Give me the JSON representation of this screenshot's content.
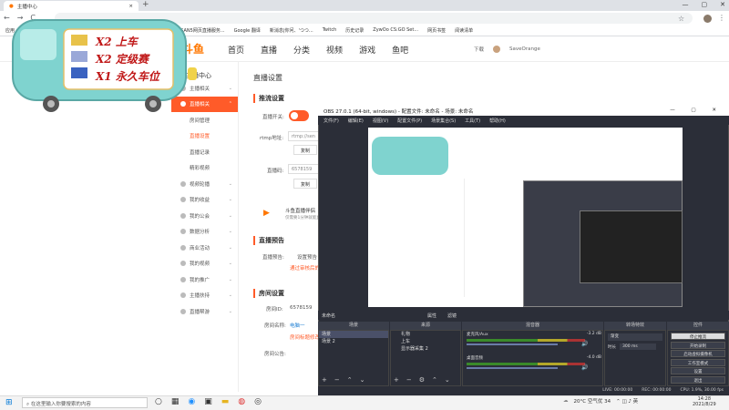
{
  "browser": {
    "tab_title": "主播中心",
    "tab_close": "×",
    "new_tab": "+",
    "win_min": "—",
    "win_max": "▢",
    "win_close": "✕",
    "back": "←",
    "forward": "→",
    "reload": "C",
    "bookmarks": [
      "应用",
      "...",
      "Debian",
      "reddit",
      "Gmail",
      "YouTube",
      "百度",
      "主播中心",
      "SAN5网页直播服务...",
      "Google 翻译",
      "新消息|你问、'つつ...",
      "Twitch",
      "历史记录",
      "ZywOo CS:GO Set...",
      "网页书签",
      "阅读清单"
    ]
  },
  "site": {
    "logo": "斗鱼",
    "topnav": [
      "首页",
      "直播",
      "分类",
      "视频",
      "游戏",
      "鱼吧"
    ],
    "download": "下载",
    "username": "SaveOrange",
    "sidebar_title": "主播中心",
    "sidebar": [
      {
        "label": "主播相关",
        "active": false,
        "sub": false
      },
      {
        "label": "直播相关",
        "active": true,
        "sub": false
      },
      {
        "label": "房间管理",
        "active": false,
        "sub": true
      },
      {
        "label": "直播设置",
        "active": false,
        "sub": true,
        "on": true
      },
      {
        "label": "直播记录",
        "active": false,
        "sub": true
      },
      {
        "label": "精彩视频",
        "active": false,
        "sub": true
      },
      {
        "label": "视频轮播",
        "active": false,
        "sub": false
      },
      {
        "label": "我的收益",
        "active": false,
        "sub": false
      },
      {
        "label": "我的公会",
        "active": false,
        "sub": false
      },
      {
        "label": "数据分析",
        "active": false,
        "sub": false
      },
      {
        "label": "商业活动",
        "active": false,
        "sub": false
      },
      {
        "label": "我的视频",
        "active": false,
        "sub": false
      },
      {
        "label": "我的推广",
        "active": false,
        "sub": false
      },
      {
        "label": "主播扶持",
        "active": false,
        "sub": false
      },
      {
        "label": "直播帮游",
        "active": false,
        "sub": false
      }
    ],
    "page_title": "直播设置",
    "section_stream": "推流设置",
    "stream_toggle_label": "直播开关:",
    "rtmp_label": "rtmp地址:",
    "rtmp_value": "rtmp://sen",
    "copy_label": "复制",
    "code_label": "直播码:",
    "code_value": "6578159",
    "tool_title": "斗鱼直播伴侣",
    "tool_sub": "仅需要1分钟就能直播",
    "section_preview": "直播预告",
    "preview_label": "直播预告:",
    "preview_btn": "设置预告",
    "preview_hint": "通过审核后的预告",
    "section_room": "房间设置",
    "room_id_label": "房间ID:",
    "room_id": "6578159",
    "room_name_label": "房间名称:",
    "room_name_hint1": "电脑一",
    "room_name_hint2": "房间标题修改",
    "room_notice_label": "房间公告:"
  },
  "overlay": {
    "lines": [
      "X2 上车",
      "X2 定级赛",
      "X1 永久车位"
    ]
  },
  "obs": {
    "title": "OBS 27.0.1 (64-bit, windows) - 配置文件: 未命名 - 场景: 未命名",
    "menu": [
      "文件(F)",
      "编辑(E)",
      "视图(V)",
      "配置文件(P)",
      "场景集合(S)",
      "工具(T)",
      "帮助(H)"
    ],
    "scenebar_left": "未命名",
    "scenebar_props": "属性",
    "scenebar_filter": "滤镜",
    "docks": {
      "scenes_title": "场景",
      "sources_title": "来源",
      "mixer_title": "混音器",
      "transitions_title": "转场特效",
      "controls_title": "控件"
    },
    "scenes": [
      "场景",
      "场景 2"
    ],
    "sources": [
      "礼物",
      "上车",
      "显示器采集 2"
    ],
    "mixer": [
      {
        "name": "麦克风/Aux",
        "db": "-3.2 dB"
      },
      {
        "name": "桌面音频",
        "db": "-4.0 dB"
      }
    ],
    "transition_type": "渐变",
    "duration_label": "时长",
    "duration_value": "300 ms",
    "controls": [
      "停止推流",
      "开始录制",
      "启动虚拟摄像机",
      "工作室模式",
      "设置",
      "退出"
    ],
    "status": [
      "LIVE: 00:00:00",
      "REC: 00:00:00",
      "CPU: 1.9%, 30.00 fps"
    ]
  },
  "taskbar": {
    "search_placeholder": "在这里输入你要搜索的内容",
    "weather": "20°C 空气优 34",
    "time": "14:28",
    "date": "2021/8/29"
  }
}
